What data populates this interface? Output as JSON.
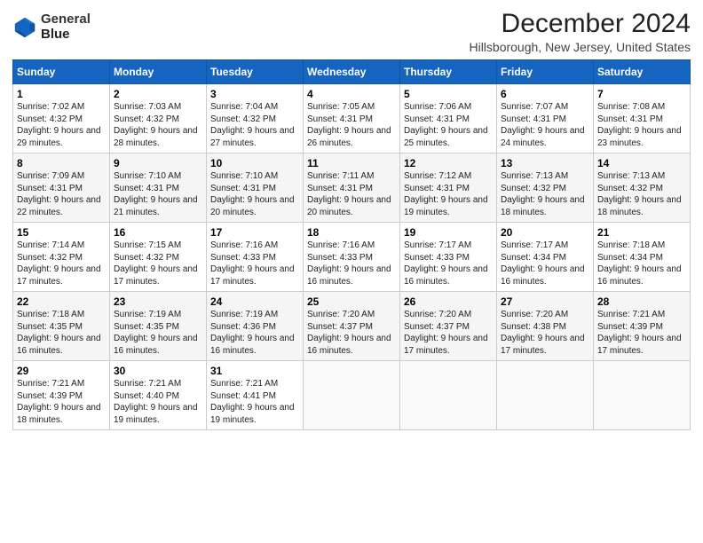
{
  "header": {
    "logo_line1": "General",
    "logo_line2": "Blue",
    "title": "December 2024",
    "subtitle": "Hillsborough, New Jersey, United States"
  },
  "weekdays": [
    "Sunday",
    "Monday",
    "Tuesday",
    "Wednesday",
    "Thursday",
    "Friday",
    "Saturday"
  ],
  "weeks": [
    [
      {
        "day": "1",
        "sunrise": "Sunrise: 7:02 AM",
        "sunset": "Sunset: 4:32 PM",
        "daylight": "Daylight: 9 hours and 29 minutes."
      },
      {
        "day": "2",
        "sunrise": "Sunrise: 7:03 AM",
        "sunset": "Sunset: 4:32 PM",
        "daylight": "Daylight: 9 hours and 28 minutes."
      },
      {
        "day": "3",
        "sunrise": "Sunrise: 7:04 AM",
        "sunset": "Sunset: 4:32 PM",
        "daylight": "Daylight: 9 hours and 27 minutes."
      },
      {
        "day": "4",
        "sunrise": "Sunrise: 7:05 AM",
        "sunset": "Sunset: 4:31 PM",
        "daylight": "Daylight: 9 hours and 26 minutes."
      },
      {
        "day": "5",
        "sunrise": "Sunrise: 7:06 AM",
        "sunset": "Sunset: 4:31 PM",
        "daylight": "Daylight: 9 hours and 25 minutes."
      },
      {
        "day": "6",
        "sunrise": "Sunrise: 7:07 AM",
        "sunset": "Sunset: 4:31 PM",
        "daylight": "Daylight: 9 hours and 24 minutes."
      },
      {
        "day": "7",
        "sunrise": "Sunrise: 7:08 AM",
        "sunset": "Sunset: 4:31 PM",
        "daylight": "Daylight: 9 hours and 23 minutes."
      }
    ],
    [
      {
        "day": "8",
        "sunrise": "Sunrise: 7:09 AM",
        "sunset": "Sunset: 4:31 PM",
        "daylight": "Daylight: 9 hours and 22 minutes."
      },
      {
        "day": "9",
        "sunrise": "Sunrise: 7:10 AM",
        "sunset": "Sunset: 4:31 PM",
        "daylight": "Daylight: 9 hours and 21 minutes."
      },
      {
        "day": "10",
        "sunrise": "Sunrise: 7:10 AM",
        "sunset": "Sunset: 4:31 PM",
        "daylight": "Daylight: 9 hours and 20 minutes."
      },
      {
        "day": "11",
        "sunrise": "Sunrise: 7:11 AM",
        "sunset": "Sunset: 4:31 PM",
        "daylight": "Daylight: 9 hours and 20 minutes."
      },
      {
        "day": "12",
        "sunrise": "Sunrise: 7:12 AM",
        "sunset": "Sunset: 4:31 PM",
        "daylight": "Daylight: 9 hours and 19 minutes."
      },
      {
        "day": "13",
        "sunrise": "Sunrise: 7:13 AM",
        "sunset": "Sunset: 4:32 PM",
        "daylight": "Daylight: 9 hours and 18 minutes."
      },
      {
        "day": "14",
        "sunrise": "Sunrise: 7:13 AM",
        "sunset": "Sunset: 4:32 PM",
        "daylight": "Daylight: 9 hours and 18 minutes."
      }
    ],
    [
      {
        "day": "15",
        "sunrise": "Sunrise: 7:14 AM",
        "sunset": "Sunset: 4:32 PM",
        "daylight": "Daylight: 9 hours and 17 minutes."
      },
      {
        "day": "16",
        "sunrise": "Sunrise: 7:15 AM",
        "sunset": "Sunset: 4:32 PM",
        "daylight": "Daylight: 9 hours and 17 minutes."
      },
      {
        "day": "17",
        "sunrise": "Sunrise: 7:16 AM",
        "sunset": "Sunset: 4:33 PM",
        "daylight": "Daylight: 9 hours and 17 minutes."
      },
      {
        "day": "18",
        "sunrise": "Sunrise: 7:16 AM",
        "sunset": "Sunset: 4:33 PM",
        "daylight": "Daylight: 9 hours and 16 minutes."
      },
      {
        "day": "19",
        "sunrise": "Sunrise: 7:17 AM",
        "sunset": "Sunset: 4:33 PM",
        "daylight": "Daylight: 9 hours and 16 minutes."
      },
      {
        "day": "20",
        "sunrise": "Sunrise: 7:17 AM",
        "sunset": "Sunset: 4:34 PM",
        "daylight": "Daylight: 9 hours and 16 minutes."
      },
      {
        "day": "21",
        "sunrise": "Sunrise: 7:18 AM",
        "sunset": "Sunset: 4:34 PM",
        "daylight": "Daylight: 9 hours and 16 minutes."
      }
    ],
    [
      {
        "day": "22",
        "sunrise": "Sunrise: 7:18 AM",
        "sunset": "Sunset: 4:35 PM",
        "daylight": "Daylight: 9 hours and 16 minutes."
      },
      {
        "day": "23",
        "sunrise": "Sunrise: 7:19 AM",
        "sunset": "Sunset: 4:35 PM",
        "daylight": "Daylight: 9 hours and 16 minutes."
      },
      {
        "day": "24",
        "sunrise": "Sunrise: 7:19 AM",
        "sunset": "Sunset: 4:36 PM",
        "daylight": "Daylight: 9 hours and 16 minutes."
      },
      {
        "day": "25",
        "sunrise": "Sunrise: 7:20 AM",
        "sunset": "Sunset: 4:37 PM",
        "daylight": "Daylight: 9 hours and 16 minutes."
      },
      {
        "day": "26",
        "sunrise": "Sunrise: 7:20 AM",
        "sunset": "Sunset: 4:37 PM",
        "daylight": "Daylight: 9 hours and 17 minutes."
      },
      {
        "day": "27",
        "sunrise": "Sunrise: 7:20 AM",
        "sunset": "Sunset: 4:38 PM",
        "daylight": "Daylight: 9 hours and 17 minutes."
      },
      {
        "day": "28",
        "sunrise": "Sunrise: 7:21 AM",
        "sunset": "Sunset: 4:39 PM",
        "daylight": "Daylight: 9 hours and 17 minutes."
      }
    ],
    [
      {
        "day": "29",
        "sunrise": "Sunrise: 7:21 AM",
        "sunset": "Sunset: 4:39 PM",
        "daylight": "Daylight: 9 hours and 18 minutes."
      },
      {
        "day": "30",
        "sunrise": "Sunrise: 7:21 AM",
        "sunset": "Sunset: 4:40 PM",
        "daylight": "Daylight: 9 hours and 19 minutes."
      },
      {
        "day": "31",
        "sunrise": "Sunrise: 7:21 AM",
        "sunset": "Sunset: 4:41 PM",
        "daylight": "Daylight: 9 hours and 19 minutes."
      },
      null,
      null,
      null,
      null
    ]
  ]
}
